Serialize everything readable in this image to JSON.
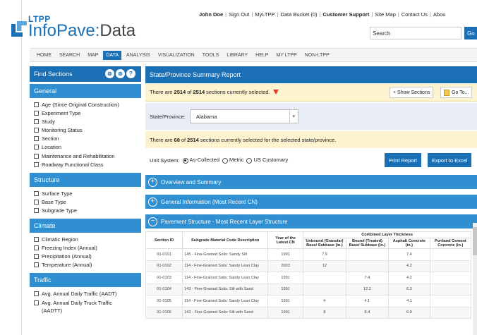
{
  "header": {
    "logo_ltpp": "LTPP",
    "logo_infopave": "InfoPave",
    "logo_colon": ":",
    "logo_data": "Data",
    "utility_links": [
      {
        "label": "John Doe",
        "strong": true
      },
      {
        "label": "Sign Out",
        "strong": false
      },
      {
        "label": "MyLTPP",
        "strong": false
      },
      {
        "label": "Data Bucket (0)",
        "strong": false
      },
      {
        "label": "Customer Support",
        "strong": true
      },
      {
        "label": "Site Map",
        "strong": false
      },
      {
        "label": "Contact Us",
        "strong": false
      },
      {
        "label": "Abou",
        "strong": false
      }
    ],
    "search_placeholder": "Search",
    "go_label": "Go"
  },
  "nav": {
    "items": [
      "HOME",
      "SEARCH",
      "MAP",
      "DATA",
      "ANALYSIS",
      "VISUALIZATION",
      "TOOLS",
      "LIBRARY",
      "HELP",
      "MY LTPP",
      "NON-LTPP"
    ],
    "active": "DATA"
  },
  "sidebar": {
    "title": "Find Sections",
    "icons": [
      "save-icon",
      "print-icon",
      "help-icon"
    ],
    "icon_glyphs": [
      "⊜",
      "⊜",
      "?"
    ],
    "sections": [
      {
        "title": "General",
        "items": [
          "Age (Since Original Construction)",
          "Experiment Type",
          "Study",
          "Monitoring Status",
          "Section",
          "Location",
          "Maintenance and Rehabilitation",
          "Roadway Functional Class"
        ]
      },
      {
        "title": "Structure",
        "items": [
          "Surface Type",
          "Base Type",
          "Subgrade Type"
        ]
      },
      {
        "title": "Climate",
        "items": [
          "Climatic Region",
          "Freezing Index (Annual)",
          "Precipitation (Annual)",
          "Temperature (Annual)"
        ]
      },
      {
        "title": "Traffic",
        "items": [
          "Avg. Annual Daily Traffic (AADT)",
          "Avg. Annual Daily Truck Traffic\n(AADTT)"
        ]
      }
    ]
  },
  "main": {
    "title": "State/Province Summary Report",
    "selection_prefix": "There are",
    "selection_count": "2514",
    "selection_of": "of",
    "selection_total": "2514",
    "selection_suffix": "sections currently selected.",
    "show_sections_label": "+ Show Sections",
    "goto_label": "Go To...",
    "state_label": "State/Province:",
    "state_value": "Alabama",
    "state_info_prefix": "There are",
    "state_info_count": "68",
    "state_info_of": "of",
    "state_info_total": "2514",
    "state_info_suffix": "sections currently selected for the selected state/province.",
    "unit_system_label": "Unit System:",
    "unit_options": [
      "As-Collected",
      "Metric",
      "US Customary"
    ],
    "unit_selected": "As-Collected",
    "print_label": "Print Report",
    "excel_label": "Export to Excel",
    "accordions": [
      {
        "label": "Overview and Summary",
        "expanded": false,
        "glyph": "+"
      },
      {
        "label": "General Information (Most Recent CN)",
        "expanded": false,
        "glyph": "+"
      },
      {
        "label": "Pavement Structure - Most Recent Layer Structure",
        "expanded": true,
        "glyph": "−"
      }
    ]
  },
  "table": {
    "group_header": "Combined Layer Thickness",
    "headers": [
      "Section ID",
      "Subgrade Material Code Description",
      "Year of the Latest CN",
      "Unbound (Granular) Base/ Subbase (in.)",
      "Bound (Treated) Base/ Subbase (in.)",
      "Asphalt Concrete (in.)",
      "Portland Cement Concrete (in.)"
    ],
    "rows": [
      [
        "01-0101",
        "145 - Fine-Grained Soils: Sandy Silt",
        "1991",
        "7.9",
        "",
        "7.4",
        ""
      ],
      [
        "01-0102",
        "114 - Fine-Grained Soils: Sandy Lean Clay",
        "2003",
        "12",
        "",
        "4.2",
        ""
      ],
      [
        "01-0103",
        "114 - Fine-Grained Soils: Sandy Lean Clay",
        "1991",
        "",
        "7.4",
        "4.2",
        ""
      ],
      [
        "01-0104",
        "143 - Fine-Grained Soils: Silt with Sand",
        "1991",
        "",
        "12.2",
        "6.3",
        ""
      ],
      [
        "01-0105",
        "114 - Fine-Grained Soils: Sandy Lean Clay",
        "1991",
        "4",
        "4.1",
        "4.1",
        ""
      ],
      [
        "01-0106",
        "143 - Fine-Grained Soils: Silt with Sand",
        "1991",
        "8",
        "8.4",
        "6.9",
        ""
      ]
    ]
  },
  "colors": {
    "primary": "#1a6fb5",
    "section_blue": "#2f8fd0",
    "info_yellow": "#fdf3cf",
    "state_bar": "#e9edf5"
  }
}
